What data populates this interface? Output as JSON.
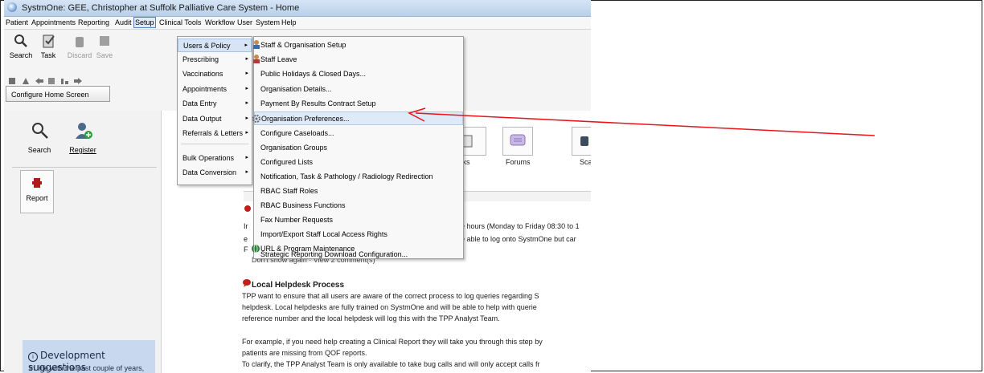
{
  "window": {
    "title": "SystmOne: GEE, Christopher at Suffolk Palliative Care System - Home"
  },
  "menubar": [
    "Patient",
    "Appointments",
    "Reporting",
    "Audit",
    "Setup",
    "Clinical Tools",
    "Workflow",
    "User",
    "System",
    "Help"
  ],
  "toolbar": {
    "search": "Search",
    "task": "Task",
    "discard": "Discard",
    "save": "Save",
    "configure_home": "Configure Home Screen"
  },
  "left_panel": {
    "search": "Search",
    "register": "Register",
    "report": "Report"
  },
  "right_tiles": {
    "tasks_partial": "sks",
    "forums": "Forums",
    "scan_partial": "Scar"
  },
  "setup_menu": [
    {
      "label": "Users & Policy",
      "arrow": "▸"
    },
    {
      "label": "Prescribing",
      "arrow": "▸"
    },
    {
      "label": "Vaccinations",
      "arrow": "▸"
    },
    {
      "label": "Appointments",
      "arrow": "▸"
    },
    {
      "label": "Data Entry",
      "arrow": "▸"
    },
    {
      "label": "Data Output",
      "arrow": "▸"
    },
    {
      "label": "Referrals & Letters",
      "arrow": "▸"
    },
    {
      "label": "Bulk Operations",
      "arrow": "▸"
    },
    {
      "label": "Data Conversion",
      "arrow": "▸"
    }
  ],
  "users_policy_submenu": [
    "Staff & Organisation Setup",
    "Staff Leave",
    "Public Holidays & Closed Days...",
    "Organisation Details...",
    "Payment By Results Contract Setup",
    "Organisation Preferences...",
    "Configure Caseloads...",
    "Organisation Groups",
    "Configured Lists",
    "Notification, Task & Pathology / Radiology Redirection",
    "RBAC Staff Roles",
    "RBAC Business Functions",
    "Fax Number Requests",
    "Import/Export Staff Local Access Rights",
    "URL & Program Maintenance",
    "Strategic Reporting Download Configuration..."
  ],
  "news": {
    "frag1": "e hours (Monday to Friday 08:30 to 1",
    "frag2": "e able to log onto SystmOne but car",
    "frag_links": "Don't show again · View 2 comment(s)",
    "left_I": "Ir",
    "left_e": "e",
    "left_F": "F",
    "local_title": "Local Helpdesk Process",
    "local_lines": [
      "TPP want to ensure that all users are aware of the correct process to log queries regarding S",
      "helpdesk. Local helpdesks are fully trained on SystmOne and will be able to help with querie",
      "reference number and the local helpdesk will log this with the TPP Analyst Team.",
      "",
      "For example, if you need help creating a Clinical Report they will take you through this step by",
      "patients are missing from QOF reports.",
      "To clarify, the TPP Analyst Team is only available to take bug calls and will only accept calls fr"
    ]
  },
  "dev": {
    "title": "Development suggestions",
    "text": "In line with the past couple of years, TPP will not"
  },
  "colors": {
    "arrow": "#e8141a",
    "menu_highlight": "#dfeaf8",
    "dev_box": "#c8d9ef"
  }
}
